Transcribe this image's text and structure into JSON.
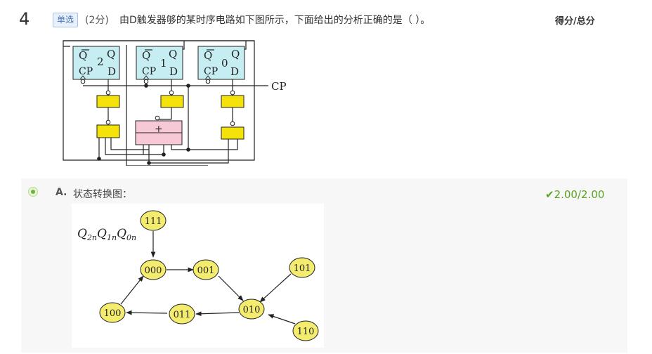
{
  "question": {
    "number": "4",
    "type_label": "单选",
    "score_label": "(2分)",
    "text": "由D触发器够的某时序电路如下图所示，下面给出的分析正确的是（ ）。",
    "score_header": "得分/总分"
  },
  "circuit": {
    "ff_labels": {
      "qbar": "Q",
      "q": "Q",
      "cp": "CP",
      "d": "D"
    },
    "ff_indices": [
      "2",
      "1",
      "0"
    ],
    "adder_label": "+",
    "clock_label": "CP"
  },
  "option": {
    "letter": "A.",
    "text": "状态转换图：",
    "score_check": "✔",
    "score_value": "2.00/2.00"
  },
  "state_diagram": {
    "label_letter": "Q",
    "label_subs": [
      "2n",
      "1n",
      "0n"
    ],
    "states": [
      "111",
      "000",
      "001",
      "101",
      "010",
      "100",
      "011",
      "110"
    ]
  },
  "colors": {
    "ff_fill": "#c6eef2",
    "gate_fill": "#f5e20a",
    "adder_fill": "#f7c9d6",
    "state_fill": "#f4ec6e",
    "correct_green": "#5ba31f"
  }
}
